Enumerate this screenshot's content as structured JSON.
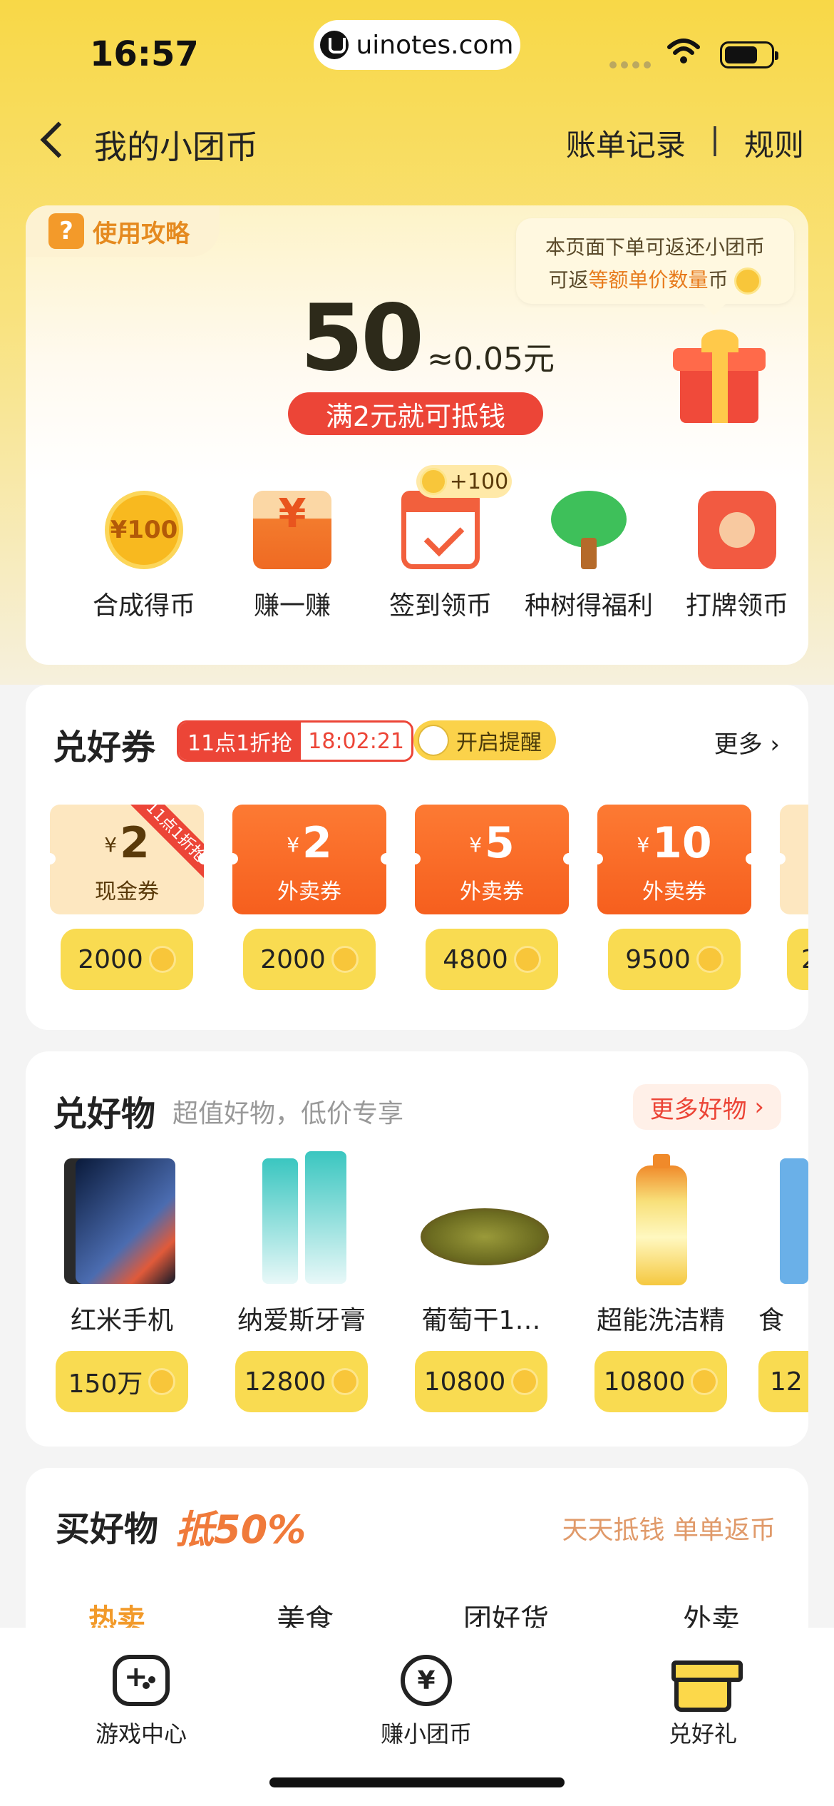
{
  "status": {
    "time": "16:57",
    "url": "uinotes.com"
  },
  "nav": {
    "title": "我的小团币",
    "links": [
      "账单记录",
      "|",
      "规则"
    ]
  },
  "header": {
    "guide_label": "使用攻略",
    "tip_line1": "本页面下单可返还小团币",
    "tip_prefix": "可返",
    "tip_highlight": "等额单价数量",
    "tip_suffix": "币",
    "balance": "50",
    "balance_equiv": "≈0.05元",
    "redeem_hint": "满2元就可抵钱",
    "checkin_bonus": "+100"
  },
  "shortcuts": [
    {
      "label": "合成得币",
      "icon": "coin-100-icon",
      "icon_text": "¥100"
    },
    {
      "label": "赚一赚",
      "icon": "red-envelope-icon",
      "icon_text": "¥"
    },
    {
      "label": "签到领币",
      "icon": "calendar-check-icon"
    },
    {
      "label": "种树得福利",
      "icon": "tree-icon"
    },
    {
      "label": "打牌领币",
      "icon": "card-game-icon"
    }
  ],
  "coupons": {
    "title": "兑好券",
    "flash_label": "11点1折抢",
    "countdown": "18:02:21",
    "remind_label": "开启提醒",
    "more": "更多",
    "items": [
      {
        "currency": "¥",
        "amount": "2",
        "type": "现金券",
        "price": "2000",
        "ribbon": "11点1折抢"
      },
      {
        "currency": "¥",
        "amount": "2",
        "type": "外卖券",
        "price": "2000"
      },
      {
        "currency": "¥",
        "amount": "5",
        "type": "外卖券",
        "price": "4800"
      },
      {
        "currency": "¥",
        "amount": "10",
        "type": "外卖券",
        "price": "9500"
      },
      {
        "currency": "",
        "amount": "",
        "type": "",
        "price": "2"
      }
    ]
  },
  "goods": {
    "title": "兑好物",
    "subtitle": "超值好物，低价专享",
    "more": "更多好物",
    "items": [
      {
        "name": "红米手机",
        "price": "150万"
      },
      {
        "name": "纳爱斯牙膏",
        "price": "12800"
      },
      {
        "name": "葡萄干1…",
        "price": "10800"
      },
      {
        "name": "超能洗洁精",
        "price": "10800"
      },
      {
        "name": "食",
        "price": "12"
      }
    ]
  },
  "shop": {
    "title": "买好物",
    "highlight": "抵50%",
    "right_text": "天天抵钱 单单返币",
    "tabs": [
      "热卖",
      "美食",
      "团好货",
      "外卖"
    ]
  },
  "tabbar": [
    {
      "label": "游戏中心",
      "icon": "gamepad-icon"
    },
    {
      "label": "赚小团币",
      "icon": "yen-coin-icon",
      "icon_text": "¥"
    },
    {
      "label": "兑好礼",
      "icon": "gift-box-icon"
    }
  ]
}
